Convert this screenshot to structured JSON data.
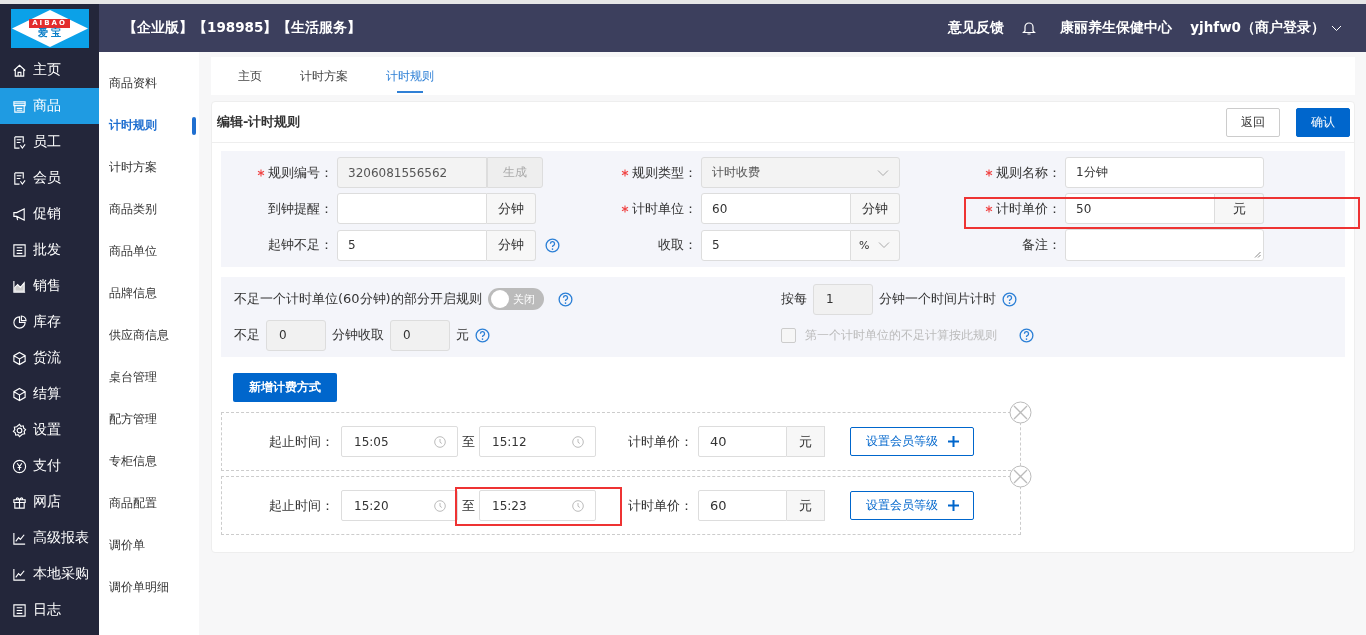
{
  "header": {
    "logo_text": "AIBAO",
    "logo_subtext": "爱 宝",
    "editions": [
      "【企业版】",
      "【198985】",
      "【生活服务】"
    ],
    "feedback": "意见反馈",
    "store": "康丽养生保健中心",
    "user": "yjhfw0（商户登录）"
  },
  "sidebar": {
    "items": [
      {
        "label": "主页",
        "selected": false
      },
      {
        "label": "商品",
        "selected": true
      },
      {
        "label": "员工",
        "selected": false
      },
      {
        "label": "会员",
        "selected": false
      },
      {
        "label": "促销",
        "selected": false
      },
      {
        "label": "批发",
        "selected": false
      },
      {
        "label": "销售",
        "selected": false
      },
      {
        "label": "库存",
        "selected": false
      },
      {
        "label": "货流",
        "selected": false
      },
      {
        "label": "结算",
        "selected": false
      },
      {
        "label": "设置",
        "selected": false
      },
      {
        "label": "支付",
        "selected": false
      },
      {
        "label": "网店",
        "selected": false
      },
      {
        "label": "高级报表",
        "selected": false
      },
      {
        "label": "本地采购",
        "selected": false
      },
      {
        "label": "日志",
        "selected": false
      }
    ]
  },
  "sub_nav": {
    "items": [
      {
        "label": "商品资料",
        "selected": false
      },
      {
        "label": "计时规则",
        "selected": true
      },
      {
        "label": "计时方案",
        "selected": false
      },
      {
        "label": "商品类别",
        "selected": false
      },
      {
        "label": "商品单位",
        "selected": false
      },
      {
        "label": "品牌信息",
        "selected": false
      },
      {
        "label": "供应商信息",
        "selected": false
      },
      {
        "label": "桌台管理",
        "selected": false
      },
      {
        "label": "配方管理",
        "selected": false
      },
      {
        "label": "专柜信息",
        "selected": false
      },
      {
        "label": "商品配置",
        "selected": false
      },
      {
        "label": "调价单",
        "selected": false
      },
      {
        "label": "调价单明细",
        "selected": false
      }
    ]
  },
  "tabs": [
    {
      "label": "主页",
      "selected": false
    },
    {
      "label": "计时方案",
      "selected": false
    },
    {
      "label": "计时规则",
      "selected": true
    }
  ],
  "card": {
    "title": "编辑-计时规则",
    "buttons": [
      {
        "label": "返回",
        "kind": "default"
      },
      {
        "label": "确认",
        "kind": "primary"
      }
    ]
  },
  "form": {
    "fields": [
      {
        "label": "规则编号：",
        "required": true,
        "kind": "input-button",
        "value": "3206081556562",
        "disabled": true,
        "button": "生成",
        "help": false,
        "highlighted": false
      },
      {
        "label": "规则类型：",
        "required": true,
        "kind": "select",
        "value": "计时收费",
        "disabled": true,
        "help": false,
        "highlighted": false
      },
      {
        "label": "规则名称：",
        "required": true,
        "kind": "input",
        "value": "1分钟",
        "disabled": false,
        "help": false,
        "highlighted": false
      },
      {
        "label": "到钟提醒：",
        "required": false,
        "kind": "input-addon",
        "addon": "分钟",
        "disabled": false,
        "help": false,
        "highlighted": false
      },
      {
        "label": "计时单位：",
        "required": true,
        "kind": "input-addon",
        "value": "60",
        "addon": "分钟",
        "disabled": false,
        "help": false,
        "highlighted": false
      },
      {
        "label": "计时单价：",
        "required": true,
        "kind": "input-addon",
        "value": "50",
        "addon": "元",
        "disabled": false,
        "help": false,
        "highlighted": true
      },
      {
        "label": "起钟不足：",
        "required": false,
        "kind": "input-addon",
        "value": "5",
        "addon": "分钟",
        "disabled": false,
        "help": true,
        "highlighted": false
      },
      {
        "label": "收取：",
        "required": false,
        "kind": "select-addon",
        "value": "5",
        "addon": "%",
        "disabled": false,
        "help": false,
        "highlighted": false
      },
      {
        "label": "备注：",
        "required": false,
        "kind": "textarea",
        "disabled": false,
        "help": false,
        "highlighted": false
      }
    ]
  },
  "partial_rule": {
    "label": "不足一个计时单位(60分钟)的部分开启规则",
    "switch": {
      "on": false,
      "text": "关闭"
    },
    "less_label": "不足",
    "less_value": "0",
    "charge_label": "分钟收取",
    "charge_value": "0",
    "unit": "元"
  },
  "slice": {
    "prefix": "按每",
    "value": "1",
    "suffix": "分钟一个时间片计时"
  },
  "first_unit_rule": {
    "label": "第一个计时单位的不足计算按此规则",
    "checked": false,
    "disabled": true
  },
  "add_button": "新增计费方式",
  "periods": [
    {
      "label": "起止时间：",
      "start": "15:05",
      "to": "至",
      "end": "15:12",
      "price_label": "计时单价：",
      "price": "40",
      "unit": "元",
      "member_button": "设置会员等级",
      "highlighted": false
    },
    {
      "label": "起止时间：",
      "start": "15:20",
      "to": "至",
      "end": "15:23",
      "price_label": "计时单价：",
      "price": "60",
      "unit": "元",
      "member_button": "设置会员等级",
      "highlighted": true
    }
  ]
}
